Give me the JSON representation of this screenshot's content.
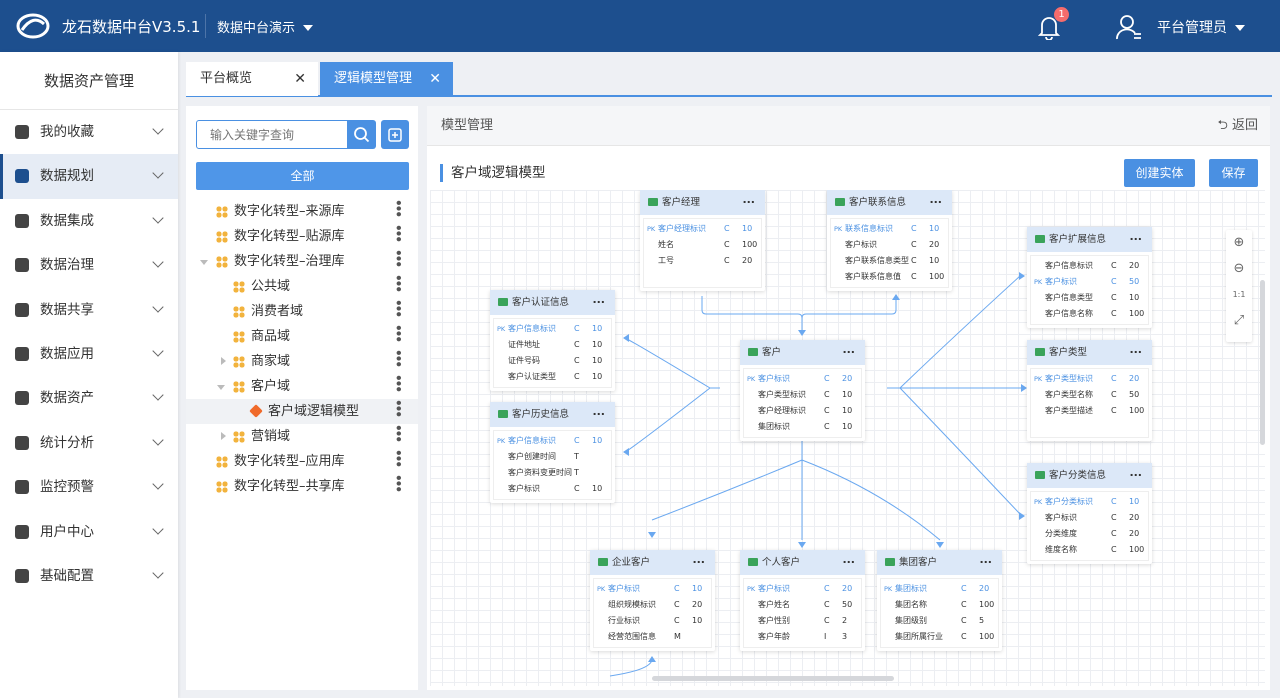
{
  "header": {
    "app_title": "龙石数据中台V3.5.1",
    "project": "数据中台演示",
    "notification_count": "1",
    "user": "平台管理员",
    "brand_color": "#1d4f8e"
  },
  "sidebar": {
    "title": "数据资产管理",
    "items": [
      {
        "label": "我的收藏",
        "icon": "star-icon"
      },
      {
        "label": "数据规划",
        "icon": "layers-icon",
        "active": true
      },
      {
        "label": "数据集成",
        "icon": "cubes-icon"
      },
      {
        "label": "数据治理",
        "icon": "database-icon"
      },
      {
        "label": "数据共享",
        "icon": "cloud-icon"
      },
      {
        "label": "数据应用",
        "icon": "recycle-icon"
      },
      {
        "label": "数据资产",
        "icon": "yen-icon"
      },
      {
        "label": "统计分析",
        "icon": "pie-icon"
      },
      {
        "label": "监控预警",
        "icon": "video-icon"
      },
      {
        "label": "用户中心",
        "icon": "user-icon"
      },
      {
        "label": "基础配置",
        "icon": "grid-icon"
      }
    ]
  },
  "tabs": [
    {
      "label": "平台概览",
      "close": "✕"
    },
    {
      "label": "逻辑模型管理",
      "close": "✕",
      "active": true
    }
  ],
  "tree": {
    "search_placeholder": "输入关键字查询",
    "all_label": "全部",
    "items": [
      {
        "label": "数字化转型–来源库",
        "level": 0,
        "expand": ""
      },
      {
        "label": "数字化转型–贴源库",
        "level": 0,
        "expand": ""
      },
      {
        "label": "数字化转型–治理库",
        "level": 0,
        "expand": "open"
      },
      {
        "label": "公共域",
        "level": 1,
        "expand": ""
      },
      {
        "label": "消费者域",
        "level": 1,
        "expand": ""
      },
      {
        "label": "商品域",
        "level": 1,
        "expand": ""
      },
      {
        "label": "商家域",
        "level": 1,
        "expand": "closed"
      },
      {
        "label": "客户域",
        "level": 1,
        "expand": "open"
      },
      {
        "label": "客户域逻辑模型",
        "level": 2,
        "expand": "",
        "selected": true,
        "type": "model"
      },
      {
        "label": "营销域",
        "level": 1,
        "expand": "closed"
      },
      {
        "label": "数字化转型–应用库",
        "level": 0,
        "expand": ""
      },
      {
        "label": "数字化转型–共享库",
        "level": 0,
        "expand": ""
      }
    ]
  },
  "main": {
    "header": "模型管理",
    "back": "返回",
    "section_title": "客户域逻辑模型",
    "create_entity": "创建实体",
    "save": "保存",
    "zoom_tools": [
      "zoom-in-icon",
      "zoom-out-icon",
      "actual-size-icon",
      "fit-icon"
    ],
    "actual_size_label": "1:1"
  },
  "entities": [
    {
      "name": "客户经理",
      "fields": [
        [
          "PK",
          "客户经理标识",
          "C",
          "10"
        ],
        [
          "",
          "姓名",
          "C",
          "100"
        ],
        [
          "",
          "工号",
          "C",
          "20"
        ]
      ]
    },
    {
      "name": "客户联系信息",
      "fields": [
        [
          "PK",
          "联系信息标识",
          "C",
          "10"
        ],
        [
          "",
          "客户标识",
          "C",
          "20"
        ],
        [
          "",
          "客户联系信息类型",
          "C",
          "10"
        ],
        [
          "",
          "客户联系信息值",
          "C",
          "100"
        ]
      ]
    },
    {
      "name": "客户认证信息",
      "fields": [
        [
          "PK",
          "客户信息标识",
          "C",
          "10"
        ],
        [
          "",
          "证件地址",
          "C",
          "10"
        ],
        [
          "",
          "证件号码",
          "C",
          "10"
        ],
        [
          "",
          "客户认证类型",
          "C",
          "10"
        ]
      ]
    },
    {
      "name": "客户历史信息",
      "fields": [
        [
          "PK",
          "客户信息标识",
          "C",
          "10"
        ],
        [
          "",
          "客户创建时间",
          "T",
          ""
        ],
        [
          "",
          "客户资料变更时间",
          "T",
          ""
        ],
        [
          "",
          "客户标识",
          "C",
          "10"
        ]
      ]
    },
    {
      "name": "客户",
      "fields": [
        [
          "PK",
          "客户标识",
          "C",
          "20"
        ],
        [
          "",
          "客户类型标识",
          "C",
          "10"
        ],
        [
          "",
          "客户经理标识",
          "C",
          "10"
        ],
        [
          "",
          "集团标识",
          "C",
          "10"
        ]
      ]
    },
    {
      "name": "客户扩展信息",
      "fields": [
        [
          "",
          "客户信息标识",
          "C",
          "20"
        ],
        [
          "PK",
          "客户标识",
          "C",
          "50"
        ],
        [
          "",
          "客户信息类型",
          "C",
          "10"
        ],
        [
          "",
          "客户信息名称",
          "C",
          "100"
        ]
      ]
    },
    {
      "name": "客户类型",
      "fields": [
        [
          "PK",
          "客户类型标识",
          "C",
          "20"
        ],
        [
          "",
          "客户类型名称",
          "C",
          "50"
        ],
        [
          "",
          "客户类型描述",
          "C",
          "100"
        ]
      ]
    },
    {
      "name": "客户分类信息",
      "fields": [
        [
          "PK",
          "客户分类标识",
          "C",
          "10"
        ],
        [
          "",
          "客户标识",
          "C",
          "20"
        ],
        [
          "",
          "分类维度",
          "C",
          "20"
        ],
        [
          "",
          "维度名称",
          "C",
          "100"
        ]
      ]
    },
    {
      "name": "企业客户",
      "fields": [
        [
          "PK",
          "客户标识",
          "C",
          "10"
        ],
        [
          "",
          "组织规模标识",
          "C",
          "20"
        ],
        [
          "",
          "行业标识",
          "C",
          "10"
        ],
        [
          "",
          "经营范围信息",
          "M",
          ""
        ]
      ]
    },
    {
      "name": "个人客户",
      "fields": [
        [
          "PK",
          "客户标识",
          "C",
          "20"
        ],
        [
          "",
          "客户姓名",
          "C",
          "50"
        ],
        [
          "",
          "客户性别",
          "C",
          "2"
        ],
        [
          "",
          "客户年龄",
          "I",
          "3"
        ]
      ]
    },
    {
      "name": "集团客户",
      "fields": [
        [
          "PK",
          "集团标识",
          "C",
          "20"
        ],
        [
          "",
          "集团名称",
          "C",
          "100"
        ],
        [
          "",
          "集团级别",
          "C",
          "5"
        ],
        [
          "",
          "集团所属行业",
          "C",
          "100"
        ]
      ]
    }
  ]
}
